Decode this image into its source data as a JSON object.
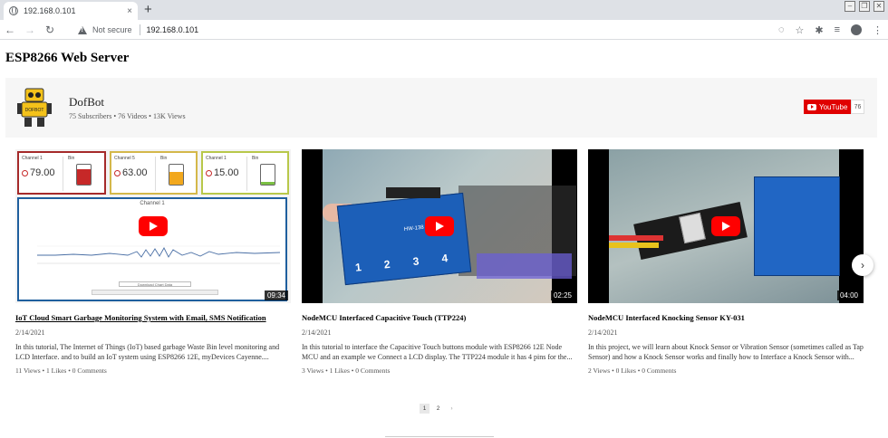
{
  "browser": {
    "tab_title": "192.168.0.101",
    "tab_close": "×",
    "new_tab": "+",
    "security_label": "Not secure",
    "url": "192.168.0.101",
    "back": "←",
    "forward": "→",
    "reload": "↻"
  },
  "page": {
    "title": "ESP8266 Web Server"
  },
  "channel": {
    "name": "DofBot",
    "logo_text": "DOFBOT",
    "stats": "75 Subscribers  •  76 Videos  •  13K Views",
    "youtube_label": "YouTube",
    "subscriber_count": "76"
  },
  "videos": [
    {
      "title": "IoT Cloud Smart Garbage Monitoring System with Email, SMS Notification",
      "date": "2/14/2021",
      "description": "In this tutorial, The Internet of Things (IoT) based garbage Waste Bin level monitoring and LCD Interface. and to build an IoT system using ESP8266 12E, myDevices Cayenne....",
      "stats": "11 Views  •  1 Likes  •  0 Comments",
      "duration": "09:34",
      "thumbnail": {
        "gauges": [
          {
            "label": "Channel 1",
            "bin_label": "Bin",
            "value": "79.00",
            "level": 0.79,
            "color": "#c62828",
            "border": "#a52a2a"
          },
          {
            "label": "Channel 5",
            "bin_label": "Bin",
            "value": "63.00",
            "level": 0.63,
            "color": "#f2a81d",
            "border": "#d4b84a"
          },
          {
            "label": "Channel 1",
            "bin_label": "Bin",
            "value": "15.00",
            "level": 0.15,
            "color": "#7bc043",
            "border": "#b8c84a"
          }
        ],
        "chart_title": "Channel 1",
        "download_label": "Download Chart Data"
      }
    },
    {
      "title": "NodeMCU Interfaced Capacitive Touch (TTP224)",
      "date": "2/14/2021",
      "description": "In this tutorial to interface the Capacitive Touch buttons module with ESP8266 12E Node MCU and an example we Connect a LCD display. The TTP224 module it has 4 pins for the...",
      "stats": "3 Views  •  1 Likes  •  0 Comments",
      "duration": "02:25",
      "thumbnail": {
        "module_label": "HW-138",
        "pads": [
          "1",
          "2",
          "3",
          "4"
        ]
      }
    },
    {
      "title": "NodeMCU Interfaced Knocking Sensor KY-031",
      "date": "2/14/2021",
      "description": "In this project, we will learn about Knock Sensor or Vibration Sensor (sometimes called as Tap Sensor) and how a Knock Sensor works and finally how to Interface a Knock Sensor with...",
      "stats": "2 Views  •  0 Likes  •  0 Comments",
      "duration": "04:00"
    }
  ],
  "pagination": {
    "pages": [
      "1",
      "2"
    ],
    "next": "›"
  },
  "carousel_next": "›"
}
